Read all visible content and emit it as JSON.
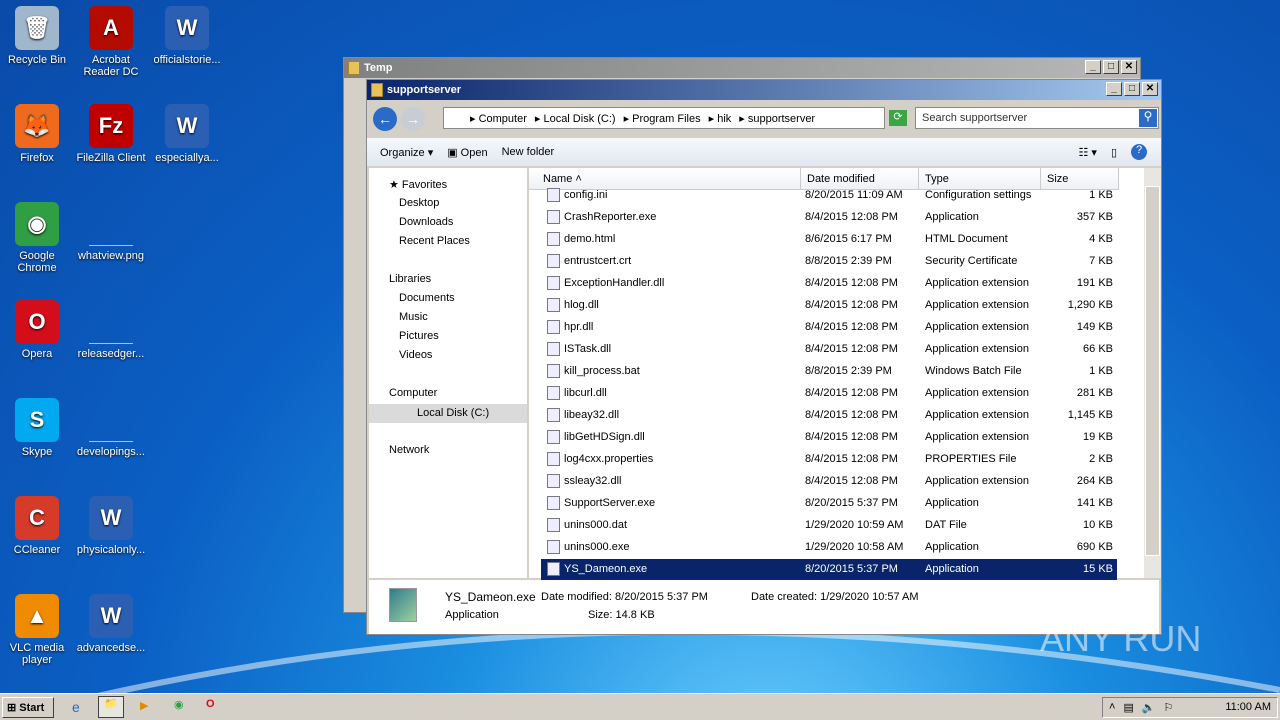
{
  "desktop": {
    "icons": [
      {
        "label": "Recycle Bin",
        "glyph": "🗑",
        "color": "#9fb6cc"
      },
      {
        "label": "Acrobat Reader DC",
        "glyph": "A",
        "color": "#b30b00"
      },
      {
        "label": "officialstorie...",
        "glyph": "W",
        "color": "#2b5fb4"
      },
      {
        "label": "Firefox",
        "glyph": "🦊",
        "color": "#f06a1e"
      },
      {
        "label": "FileZilla Client",
        "glyph": "Fz",
        "color": "#bf0000"
      },
      {
        "label": "especiallya...",
        "glyph": "W",
        "color": "#2b5fb4"
      },
      {
        "label": "Google Chrome",
        "glyph": "◉",
        "color": "#2f9e44"
      },
      {
        "label": "whatview.png",
        "glyph": "",
        "color": "#1a7fd6"
      },
      {
        "label": "Opera",
        "glyph": "O",
        "color": "#d40d1a"
      },
      {
        "label": "releasedger...",
        "glyph": "",
        "color": "#1a7fd6"
      },
      {
        "label": "Skype",
        "glyph": "S",
        "color": "#00a9f0"
      },
      {
        "label": "developings...",
        "glyph": "",
        "color": "#1a7fd6"
      },
      {
        "label": "CCleaner",
        "glyph": "C",
        "color": "#d63b2a"
      },
      {
        "label": "physicalonly...",
        "glyph": "W",
        "color": "#2b5fb4"
      },
      {
        "label": "VLC media player",
        "glyph": "▲",
        "color": "#f08a00"
      },
      {
        "label": "advancedse...",
        "glyph": "W",
        "color": "#2b5fb4"
      }
    ]
  },
  "back_window": {
    "title": "Temp"
  },
  "window": {
    "title": "supportserver",
    "breadcrumb": [
      "Computer",
      "Local Disk (C:)",
      "Program Files",
      "hik",
      "supportserver"
    ],
    "search_placeholder": "Search supportserver",
    "toolbar": {
      "organize": "Organize",
      "open": "Open",
      "new_folder": "New folder"
    },
    "nav": {
      "favorites": "Favorites",
      "fav_items": [
        "Desktop",
        "Downloads",
        "Recent Places"
      ],
      "libraries": "Libraries",
      "lib_items": [
        "Documents",
        "Music",
        "Pictures",
        "Videos"
      ],
      "computer": "Computer",
      "local_disk": "Local Disk (C:)",
      "network": "Network"
    },
    "columns": [
      "Name",
      "Date modified",
      "Type",
      "Size"
    ],
    "files": [
      {
        "name": "config.ini",
        "date": "8/20/2015 11:09 AM",
        "type": "Configuration settings",
        "size": "1 KB"
      },
      {
        "name": "CrashReporter.exe",
        "date": "8/4/2015 12:08 PM",
        "type": "Application",
        "size": "357 KB"
      },
      {
        "name": "demo.html",
        "date": "8/6/2015 6:17 PM",
        "type": "HTML Document",
        "size": "4 KB"
      },
      {
        "name": "entrustcert.crt",
        "date": "8/8/2015 2:39 PM",
        "type": "Security Certificate",
        "size": "7 KB"
      },
      {
        "name": "ExceptionHandler.dll",
        "date": "8/4/2015 12:08 PM",
        "type": "Application extension",
        "size": "191 KB"
      },
      {
        "name": "hlog.dll",
        "date": "8/4/2015 12:08 PM",
        "type": "Application extension",
        "size": "1,290 KB"
      },
      {
        "name": "hpr.dll",
        "date": "8/4/2015 12:08 PM",
        "type": "Application extension",
        "size": "149 KB"
      },
      {
        "name": "ISTask.dll",
        "date": "8/4/2015 12:08 PM",
        "type": "Application extension",
        "size": "66 KB"
      },
      {
        "name": "kill_process.bat",
        "date": "8/8/2015 2:39 PM",
        "type": "Windows Batch File",
        "size": "1 KB"
      },
      {
        "name": "libcurl.dll",
        "date": "8/4/2015 12:08 PM",
        "type": "Application extension",
        "size": "281 KB"
      },
      {
        "name": "libeay32.dll",
        "date": "8/4/2015 12:08 PM",
        "type": "Application extension",
        "size": "1,145 KB"
      },
      {
        "name": "libGetHDSign.dll",
        "date": "8/4/2015 12:08 PM",
        "type": "Application extension",
        "size": "19 KB"
      },
      {
        "name": "log4cxx.properties",
        "date": "8/4/2015 12:08 PM",
        "type": "PROPERTIES File",
        "size": "2 KB"
      },
      {
        "name": "ssleay32.dll",
        "date": "8/4/2015 12:08 PM",
        "type": "Application extension",
        "size": "264 KB"
      },
      {
        "name": "SupportServer.exe",
        "date": "8/20/2015 5:37 PM",
        "type": "Application",
        "size": "141 KB"
      },
      {
        "name": "unins000.dat",
        "date": "1/29/2020 10:59 AM",
        "type": "DAT File",
        "size": "10 KB"
      },
      {
        "name": "unins000.exe",
        "date": "1/29/2020 10:58 AM",
        "type": "Application",
        "size": "690 KB"
      },
      {
        "name": "YS_Dameon.exe",
        "date": "8/20/2015 5:37 PM",
        "type": "Application",
        "size": "15 KB"
      }
    ],
    "details": {
      "name": "YS_Dameon.exe",
      "type": "Application",
      "modified": "Date modified: 8/20/2015 5:37 PM",
      "size": "Size: 14.8 KB",
      "created": "Date created: 1/29/2020 10:57 AM"
    }
  },
  "taskbar": {
    "start": "Start",
    "clock": "11:00 AM"
  },
  "watermark": "ANY RUN"
}
